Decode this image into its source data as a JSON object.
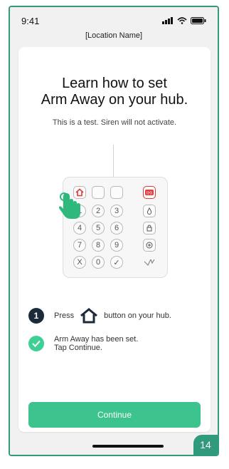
{
  "status": {
    "time": "9:41"
  },
  "header": {
    "location": "[Location Name]"
  },
  "card": {
    "title_line1": "Learn how to set",
    "title_line2": "Arm Away on your hub.",
    "subtitle": "This is a test. Siren will not activate."
  },
  "keypad": {
    "keys": [
      "1",
      "2",
      "3",
      "4",
      "5",
      "6",
      "7",
      "8",
      "9",
      "X",
      "0",
      "✓"
    ],
    "side_icons": [
      "siren-icon",
      "fire-icon",
      "lock-icon",
      "medical-icon",
      "vivint-logo-icon"
    ]
  },
  "steps": [
    {
      "number": "1",
      "before": "Press",
      "after": "button on your hub."
    },
    {
      "line1": "Arm Away has been set.",
      "line2": "Tap Continue."
    }
  ],
  "button": {
    "continue": "Continue"
  },
  "badge": "14",
  "colors": {
    "accent": "#3dc48e",
    "frame": "#2f9b7c",
    "dark": "#1b2b3c",
    "alarm": "#e03a3a"
  }
}
